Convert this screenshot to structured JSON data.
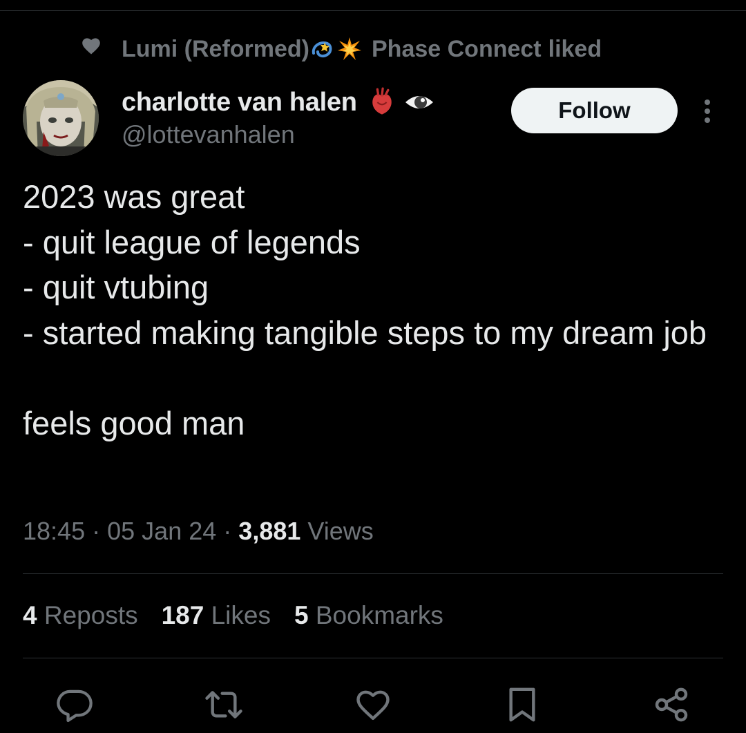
{
  "context": {
    "liked_by": "Lumi (Reformed)",
    "liked_by_emojis": [
      "comet-sparkle-emoji",
      "collision-emoji"
    ],
    "liked_by_2": "Phase Connect",
    "action_text": "liked"
  },
  "author": {
    "display_name": "charlotte van halen",
    "name_emojis": [
      "anatomical-heart-emoji",
      "eye-emoji"
    ],
    "handle": "@lottevanhalen"
  },
  "follow_label": "Follow",
  "tweet": {
    "lines": [
      "2023 was great",
      "- quit league of legends",
      "- quit vtubing",
      "- started making tangible steps to my dream job"
    ],
    "closing": "feels good man"
  },
  "meta": {
    "time": "18:45",
    "date": "05 Jan 24",
    "views_count": "3,881",
    "views_label": "Views",
    "separator": "·"
  },
  "stats": {
    "reposts_count": "4",
    "reposts_label": "Reposts",
    "likes_count": "187",
    "likes_label": "Likes",
    "bookmarks_count": "5",
    "bookmarks_label": "Bookmarks"
  },
  "actions": [
    "reply-icon",
    "repost-icon",
    "like-icon",
    "bookmark-icon",
    "share-icon"
  ],
  "colors": {
    "background": "#000000",
    "primary_text": "#e7e9ea",
    "secondary_text": "#71767b",
    "divider": "#2f3336",
    "follow_bg": "#eff3f4",
    "follow_text": "#0f1419"
  }
}
